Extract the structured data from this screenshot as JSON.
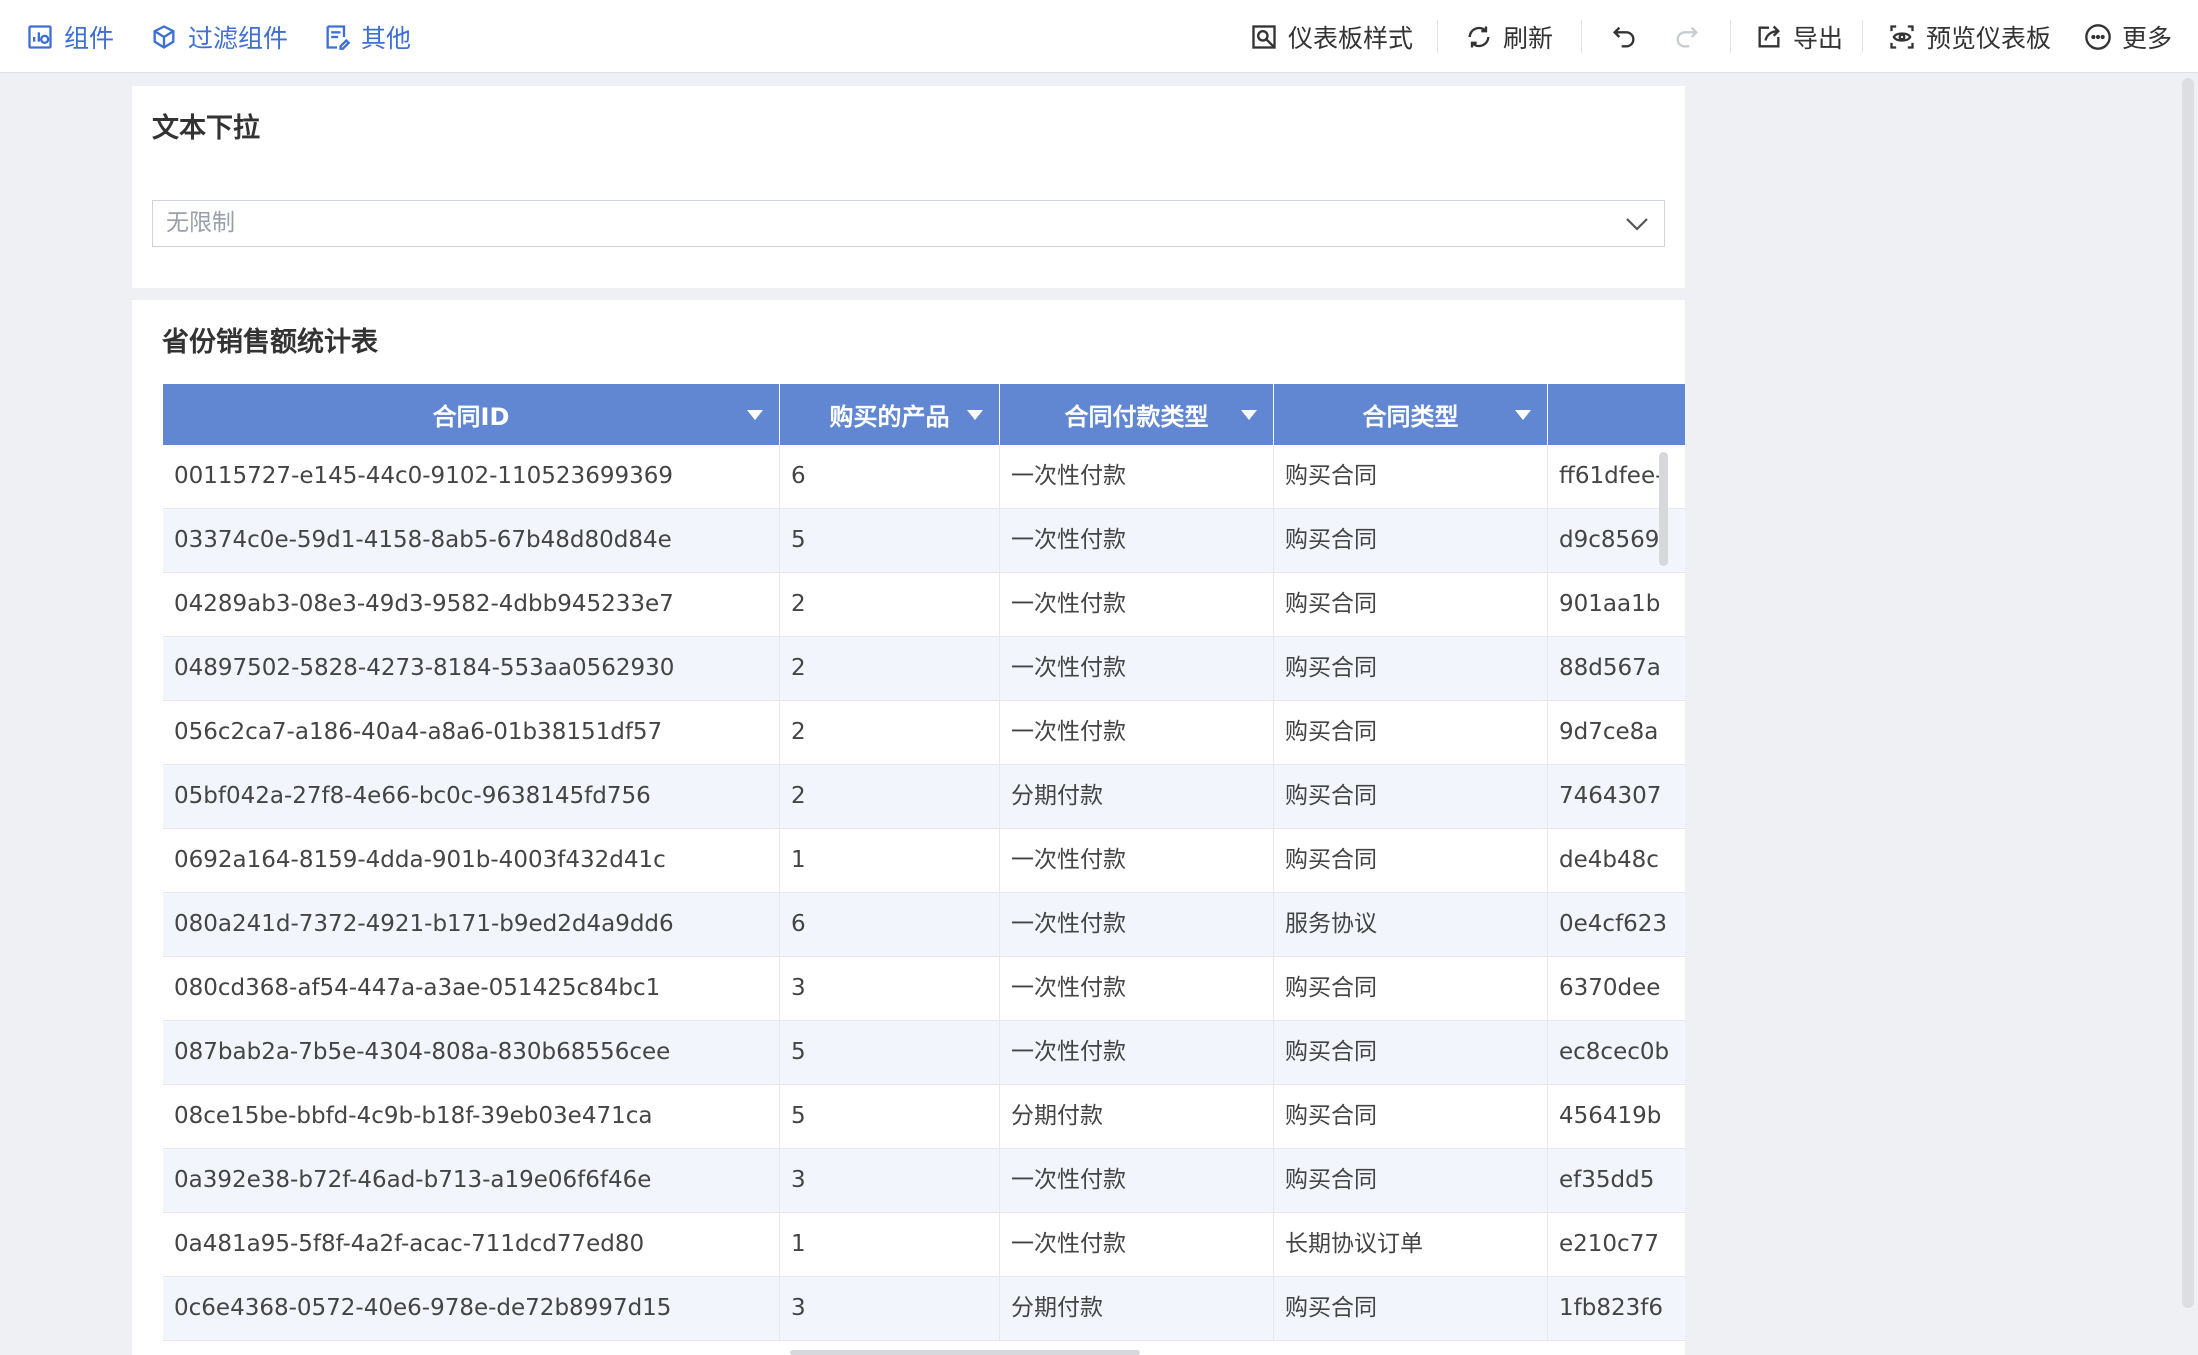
{
  "toolbar": {
    "left": {
      "components": "组件",
      "filter_components": "过滤组件",
      "other": "其他"
    },
    "right": {
      "dashboard_style": "仪表板样式",
      "refresh": "刷新",
      "export": "导出",
      "preview": "预览仪表板",
      "more": "更多"
    },
    "accent_color": "#3d6fd6"
  },
  "filter": {
    "title": "文本下拉",
    "placeholder": "无限制"
  },
  "table": {
    "title": "省份销售额统计表",
    "header_color": "#6187d3",
    "columns": [
      "合同ID",
      "购买的产品",
      "合同付款类型",
      "合同类型",
      ""
    ],
    "rows": [
      [
        "00115727-e145-44c0-9102-110523699369",
        "6",
        "一次性付款",
        "购买合同",
        "ff61dfee-"
      ],
      [
        "03374c0e-59d1-4158-8ab5-67b48d80d84e",
        "5",
        "一次性付款",
        "购买合同",
        "d9c8569"
      ],
      [
        "04289ab3-08e3-49d3-9582-4dbb945233e7",
        "2",
        "一次性付款",
        "购买合同",
        "901aa1b"
      ],
      [
        "04897502-5828-4273-8184-553aa0562930",
        "2",
        "一次性付款",
        "购买合同",
        "88d567a"
      ],
      [
        "056c2ca7-a186-40a4-a8a6-01b38151df57",
        "2",
        "一次性付款",
        "购买合同",
        "9d7ce8a"
      ],
      [
        "05bf042a-27f8-4e66-bc0c-9638145fd756",
        "2",
        "分期付款",
        "购买合同",
        "7464307"
      ],
      [
        "0692a164-8159-4dda-901b-4003f432d41c",
        "1",
        "一次性付款",
        "购买合同",
        "de4b48c"
      ],
      [
        "080a241d-7372-4921-b171-b9ed2d4a9dd6",
        "6",
        "一次性付款",
        "服务协议",
        "0e4cf623"
      ],
      [
        "080cd368-af54-447a-a3ae-051425c84bc1",
        "3",
        "一次性付款",
        "购买合同",
        "6370dee"
      ],
      [
        "087bab2a-7b5e-4304-808a-830b68556cee",
        "5",
        "一次性付款",
        "购买合同",
        "ec8cec0b"
      ],
      [
        "08ce15be-bbfd-4c9b-b18f-39eb03e471ca",
        "5",
        "分期付款",
        "购买合同",
        "456419b"
      ],
      [
        "0a392e38-b72f-46ad-b713-a19e06f6f46e",
        "3",
        "一次性付款",
        "购买合同",
        "ef35dd5"
      ],
      [
        "0a481a95-5f8f-4a2f-acac-711dcd77ed80",
        "1",
        "一次性付款",
        "长期协议订单",
        "e210c77"
      ],
      [
        "0c6e4368-0572-40e6-978e-de72b8997d15",
        "3",
        "分期付款",
        "购买合同",
        "1fb823f6"
      ]
    ]
  }
}
